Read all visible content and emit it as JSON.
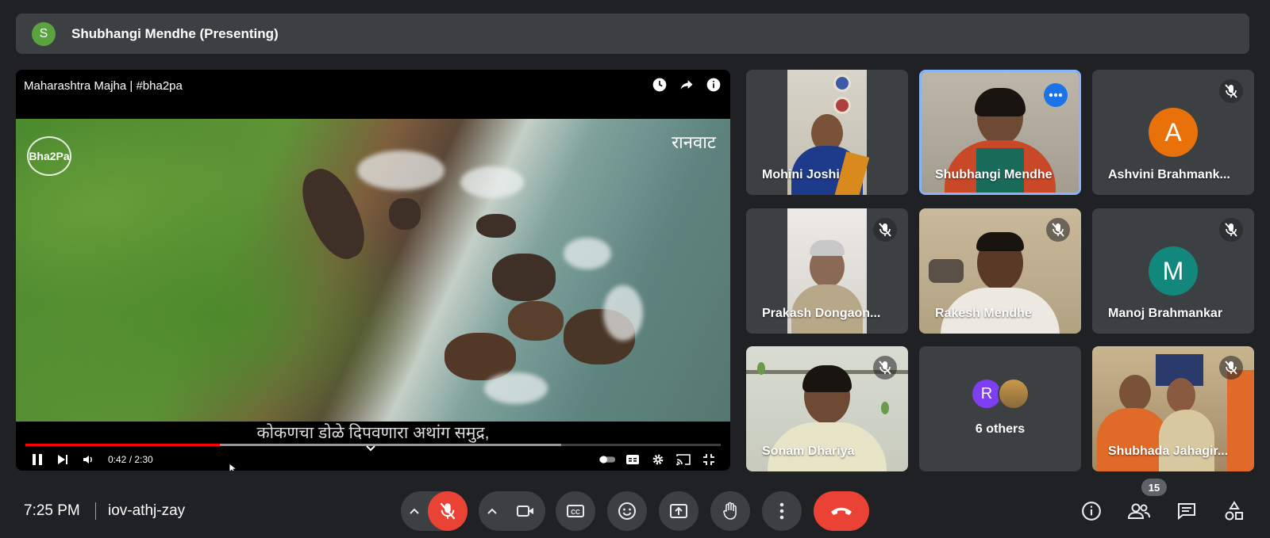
{
  "presenter": {
    "initial": "S",
    "label": "Shubhangi Mendhe (Presenting)"
  },
  "video": {
    "title": "Maharashtra Majha | #bha2pa",
    "logo_text": "Bha2Pa",
    "watermark": "रानवाट",
    "subtitle": "कोकणचा डोळे दिपवणारा अथांग समुद्र,",
    "time": "0:42 / 2:30",
    "progress": 0.28,
    "buffered": 0.77
  },
  "participants": [
    {
      "name": "Mohini Joshi",
      "type": "video"
    },
    {
      "name": "Shubhangi Mendhe",
      "type": "video",
      "active": true
    },
    {
      "name": "Ashvini Brahmank...",
      "type": "avatar",
      "initial": "A",
      "color": "#e8710a",
      "muted": true
    },
    {
      "name": "Prakash Dongaon...",
      "type": "video",
      "muted": true
    },
    {
      "name": "Rakesh Mendhe",
      "type": "video",
      "muted": true
    },
    {
      "name": "Manoj Brahmankar",
      "type": "avatar",
      "initial": "M",
      "color": "#12877c",
      "muted": true
    },
    {
      "name": "Sonam Dhariya",
      "type": "video",
      "muted": true
    },
    {
      "name": "6 others",
      "type": "others",
      "initial": "R"
    },
    {
      "name": "Shubhada Jahagir...",
      "type": "video",
      "muted": true
    }
  ],
  "meeting": {
    "time": "7:25 PM",
    "code": "iov-athj-zay"
  },
  "participant_count": "15",
  "colors": {
    "accent": "#8ab4f8",
    "danger": "#ea4335",
    "tile": "#3c4043",
    "background": "#202124"
  }
}
